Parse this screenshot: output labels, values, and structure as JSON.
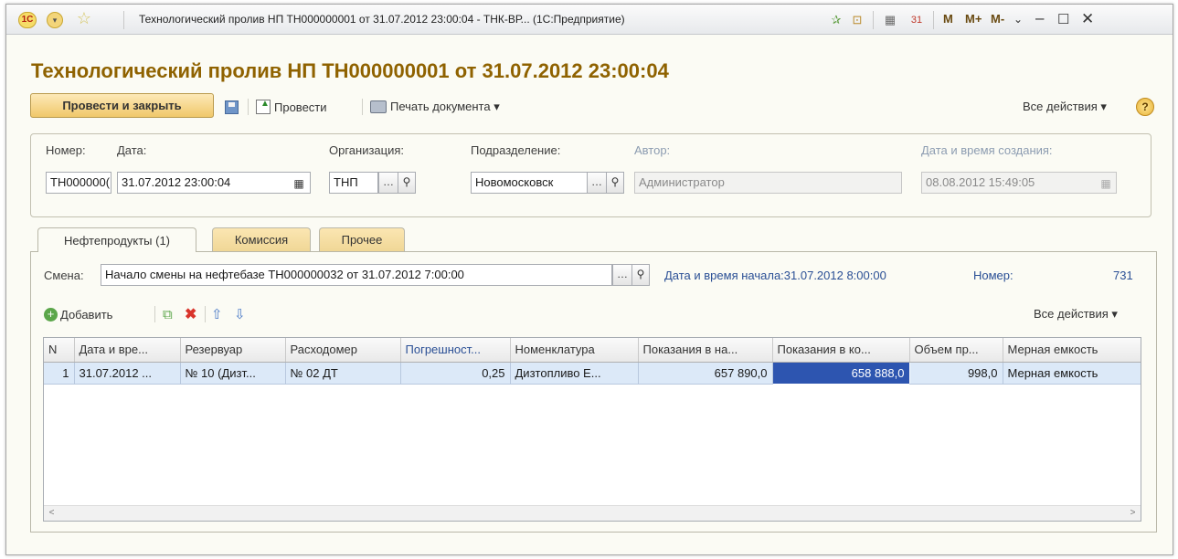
{
  "titlebar": {
    "logo": "1С",
    "title": "Технологический пролив НП ТН000000001 от 31.07.2012 23:00:04 - ТНК-ВР...  (1С:Предприятие)",
    "memory_buttons": [
      "M",
      "M+",
      "M-"
    ]
  },
  "document": {
    "title": "Технологический пролив НП ТН000000001 от 31.07.2012 23:00:04"
  },
  "toolbar": {
    "post_close_label": "Провести и закрыть",
    "post_label": "Провести",
    "print_label": "Печать документа ▾",
    "all_actions_label": "Все действия ▾",
    "help_label": "?"
  },
  "header": {
    "number_label": "Номер:",
    "number_value": "ТН000000(",
    "date_label": "Дата:",
    "date_value": "31.07.2012 23:00:04",
    "org_label": "Организация:",
    "org_value": "ТНП",
    "dept_label": "Подразделение:",
    "dept_value": "Новомосковск",
    "author_label": "Автор:",
    "author_value": "Администратор",
    "created_label": "Дата и время создания:",
    "created_value": "08.08.2012 15:49:05"
  },
  "tabs": [
    {
      "label": "Нефтепродукты (1)"
    },
    {
      "label": "Комиссия"
    },
    {
      "label": "Прочее"
    }
  ],
  "shift": {
    "label": "Смена:",
    "value": "Начало смены на нефтебазе ТН000000032 от 31.07.2012 7:00:00",
    "start_label": "Дата и время начала:",
    "start_value": "31.07.2012 8:00:00",
    "number_label": "Номер:",
    "number_value": "731"
  },
  "table_toolbar": {
    "add_label": "Добавить",
    "all_actions_label": "Все действия ▾"
  },
  "table": {
    "columns": [
      "N",
      "Дата и вре...",
      "Резервуар",
      "Расходомер",
      "Погрешност...",
      "Номенклатура",
      "Показания в на...",
      "Показания в ко...",
      "Объем пр...",
      "Мерная емкость"
    ],
    "rows": [
      [
        "1",
        "31.07.2012 ...",
        "№ 10 (Дизт...",
        "№ 02 ДТ",
        "0,25",
        "Дизтопливо Е...",
        "657 890,0",
        "658 888,0",
        "998,0",
        "Мерная емкость"
      ]
    ]
  },
  "colors": {
    "title": "#8f6200",
    "selection": "#2d55b0",
    "row_bg": "#dce9f8",
    "link": "#2a4f95"
  }
}
